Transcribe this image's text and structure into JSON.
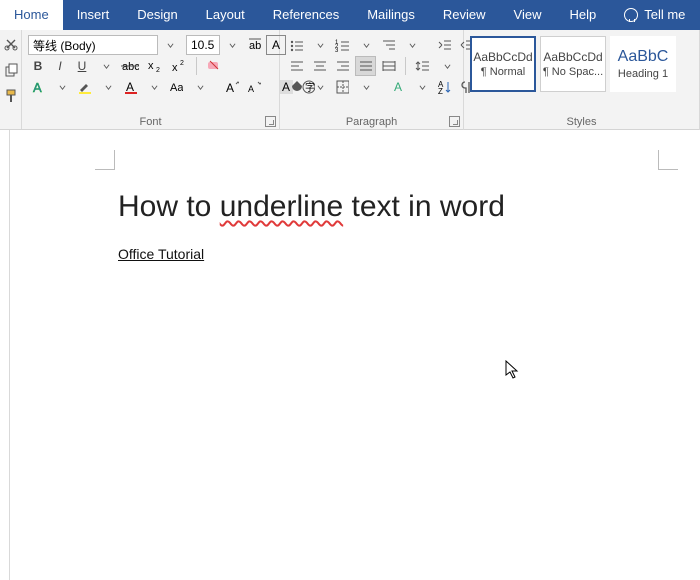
{
  "tabs": {
    "home": "Home",
    "insert": "Insert",
    "design": "Design",
    "layout": "Layout",
    "references": "References",
    "mailings": "Mailings",
    "review": "Review",
    "view": "View",
    "help": "Help",
    "tell_me": "Tell me"
  },
  "font": {
    "group_title": "Font",
    "name_value": "等线 (Body)",
    "size_value": "10.5",
    "bold": "B",
    "italic": "I",
    "underline": "U",
    "sub": "x",
    "sup": "x"
  },
  "paragraph": {
    "group_title": "Paragraph"
  },
  "styles": {
    "group_title": "Styles",
    "cards": [
      {
        "sample": "AaBbCcDd",
        "name": "¶ Normal"
      },
      {
        "sample": "AaBbCcDd",
        "name": "¶ No Spac..."
      },
      {
        "sample": "AaBbC",
        "name": "Heading 1"
      }
    ]
  },
  "doc": {
    "heading_pre": "How to ",
    "heading_err": "underline",
    "heading_post": " text in word",
    "link_text": "Office Tutorial"
  }
}
